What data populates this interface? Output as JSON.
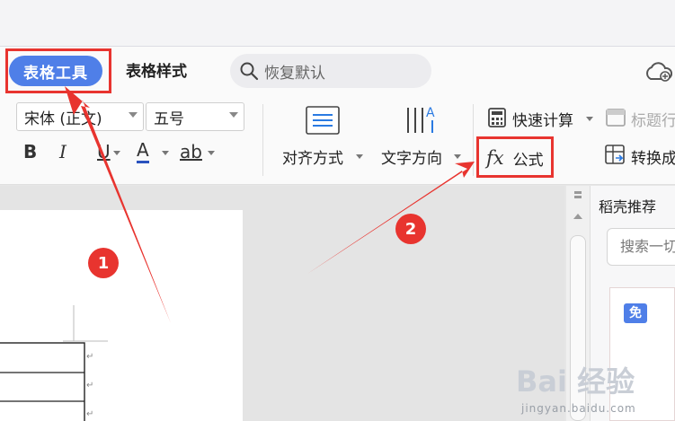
{
  "tabs": {
    "active": "表格工具",
    "second": "表格样式"
  },
  "search": {
    "placeholder": "恢复默认"
  },
  "font": {
    "family": "宋体 (正文)",
    "size": "五号"
  },
  "format": {
    "bold": "B",
    "italic": "I",
    "underline": "U",
    "font_color": "A",
    "highlight": "ab"
  },
  "tools": {
    "align": "对齐方式",
    "text_direction": "文字方向",
    "quick_calc": "快速计算",
    "title_row": "标题行",
    "formula_fx": "fx",
    "formula": "公式",
    "convert": "转换成"
  },
  "side_panel": {
    "title": "稻壳推荐",
    "search_placeholder": "搜索一切",
    "free_badge": "免"
  },
  "annotations": {
    "marker_1": "1",
    "marker_2": "2"
  },
  "watermark": {
    "brand": "Bai 经验",
    "url": "jingyan.baidu.com"
  },
  "colors": {
    "accent": "#4f7fe8",
    "annotation": "#e8342f",
    "font_color_underline": "#2a52be"
  }
}
